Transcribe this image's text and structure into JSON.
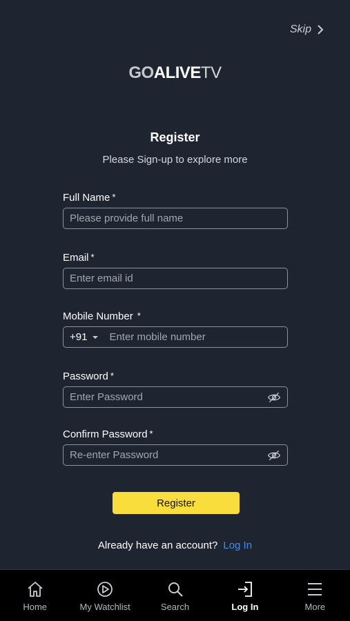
{
  "header": {
    "skip_label": "Skip",
    "logo": {
      "part1": "GO",
      "part2": "ALIVE",
      "part3": "TV"
    }
  },
  "form": {
    "title": "Register",
    "subtitle": "Please Sign-up to explore more",
    "required_mark": "*",
    "full_name": {
      "label": "Full Name",
      "placeholder": "Please provide full name",
      "value": ""
    },
    "email": {
      "label": "Email",
      "placeholder": "Enter email id",
      "value": ""
    },
    "mobile": {
      "label": "Mobile Number",
      "country_code": "+91",
      "placeholder": "Enter mobile number",
      "value": ""
    },
    "password": {
      "label": "Password",
      "placeholder": "Enter Password",
      "value": ""
    },
    "confirm_password": {
      "label": "Confirm Password",
      "placeholder": "Re-enter Password",
      "value": ""
    },
    "register_button": "Register",
    "already_text": "Already have an account?",
    "login_link": "Log In"
  },
  "nav": {
    "items": [
      {
        "label": "Home",
        "icon": "home-icon",
        "active": false
      },
      {
        "label": "My Watchlist",
        "icon": "play-circle-icon",
        "active": false
      },
      {
        "label": "Search",
        "icon": "search-icon",
        "active": false
      },
      {
        "label": "Log In",
        "icon": "login-icon",
        "active": true
      },
      {
        "label": "More",
        "icon": "menu-icon",
        "active": false
      }
    ]
  },
  "colors": {
    "background": "#1f2431",
    "accent_button": "#f9dd3d",
    "link": "#3d8fe8",
    "nav_background": "#000000"
  }
}
